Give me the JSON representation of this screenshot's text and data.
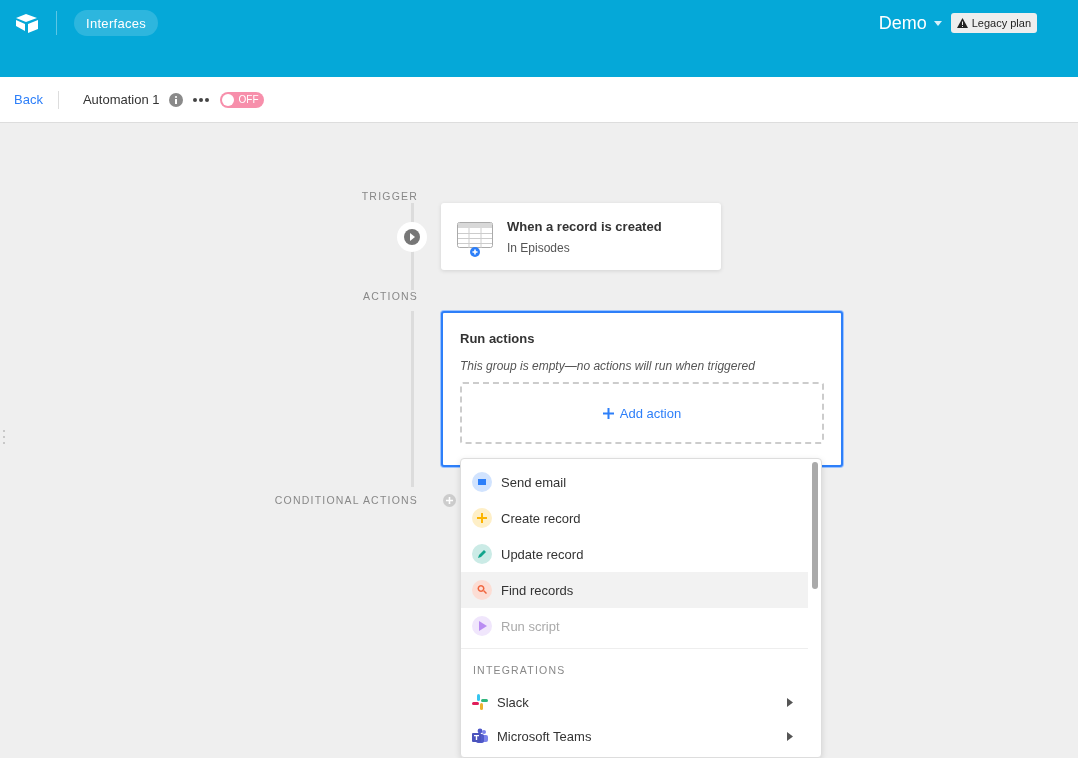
{
  "header": {
    "nav_button": "Interfaces",
    "workspace": "Demo",
    "plan_badge": "Legacy plan"
  },
  "toolbar": {
    "back": "Back",
    "title": "Automation 1",
    "toggle": {
      "on": false,
      "label": "OFF"
    }
  },
  "trigger": {
    "section_label": "TRIGGER",
    "title": "When a record is created",
    "subtitle": "In Episodes"
  },
  "actions": {
    "section_label": "ACTIONS",
    "title": "Run actions",
    "empty_note": "This group is empty—no actions will run when triggered",
    "add_button": "Add action",
    "selected": true
  },
  "conditional": {
    "section_label": "CONDITIONAL ACTIONS"
  },
  "menu": {
    "items": [
      {
        "kind": "email",
        "label": "Send email",
        "color": "#2d7ff9",
        "selected": false,
        "disabled": false
      },
      {
        "kind": "create",
        "label": "Create record",
        "color": "#fcb400",
        "selected": false,
        "disabled": false
      },
      {
        "kind": "update",
        "label": "Update record",
        "color": "#12a58c",
        "selected": false,
        "disabled": false
      },
      {
        "kind": "find",
        "label": "Find records",
        "color": "#f0643c",
        "selected": true,
        "disabled": false
      },
      {
        "kind": "script",
        "label": "Run script",
        "color": "#b98cf2",
        "selected": false,
        "disabled": true
      }
    ],
    "section_heading": "INTEGRATIONS",
    "integrations": [
      {
        "kind": "slack",
        "label": "Slack",
        "has_submenu": true
      },
      {
        "kind": "teams",
        "label": "Microsoft Teams",
        "has_submenu": true
      }
    ]
  }
}
